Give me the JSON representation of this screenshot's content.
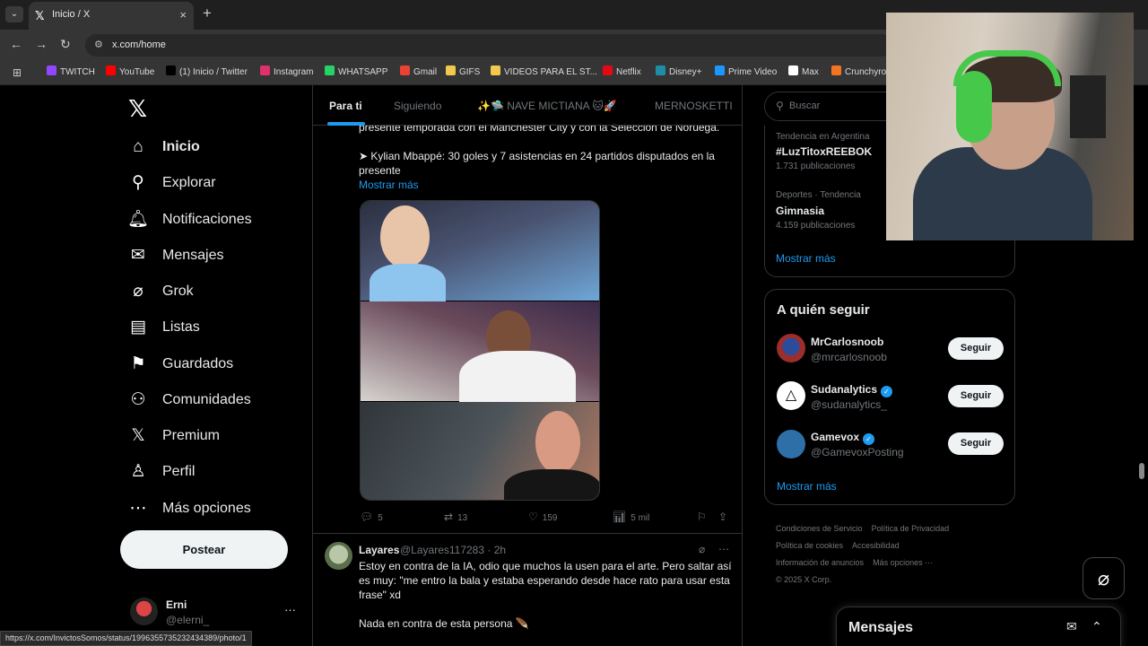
{
  "browser": {
    "tab_title": "Inicio / X",
    "tab_favicon": "𝕏",
    "url": "x.com/home",
    "new_tab": "+",
    "close_tab": "×",
    "bookmarks": [
      {
        "label": "TWITCH",
        "color": "#9146ff"
      },
      {
        "label": "YouTube",
        "color": "#ff0000"
      },
      {
        "label": "(1) Inicio / Twitter",
        "color": "#000000"
      },
      {
        "label": "Instagram",
        "color": "#e1306c"
      },
      {
        "label": "WHATSAPP",
        "color": "#25d366"
      },
      {
        "label": "Gmail",
        "color": "#ea4335"
      },
      {
        "label": "GIFS",
        "color": "#f2c94c"
      },
      {
        "label": "VIDEOS PARA EL ST...",
        "color": "#f2c94c"
      },
      {
        "label": "Netflix",
        "color": "#e50914"
      },
      {
        "label": "Disney+",
        "color": "#1e8ea8"
      },
      {
        "label": "Prime Video",
        "color": "#1a98ff"
      },
      {
        "label": "Max",
        "color": "#ffffff"
      },
      {
        "label": "Crunchyro",
        "color": "#f47521"
      }
    ],
    "status_url": "https://x.com/InvictosSomos/status/1996355735232434389/photo/1"
  },
  "nav": {
    "logo": "𝕏",
    "items": [
      {
        "label": "Inicio",
        "icon": "⌂",
        "active": true
      },
      {
        "label": "Explorar",
        "icon": "⚲"
      },
      {
        "label": "Notificaciones",
        "icon": "🔔︎"
      },
      {
        "label": "Mensajes",
        "icon": "✉"
      },
      {
        "label": "Grok",
        "icon": "⌀"
      },
      {
        "label": "Listas",
        "icon": "▤"
      },
      {
        "label": "Guardados",
        "icon": "⚑"
      },
      {
        "label": "Comunidades",
        "icon": "⚇"
      },
      {
        "label": "Premium",
        "icon": "𝕏"
      },
      {
        "label": "Perfil",
        "icon": "♙"
      },
      {
        "label": "Más opciones",
        "icon": "⋯"
      }
    ],
    "post_label": "Postear",
    "account": {
      "name": "Erni",
      "handle": "@elerni_",
      "more": "···"
    }
  },
  "feed": {
    "tabs": [
      {
        "label": "Para ti",
        "active": true
      },
      {
        "label": "Siguiendo"
      },
      {
        "label": "✨🛸 NAVE MICTIANA 🐱🚀"
      },
      {
        "label": "MERNOSKETTI"
      }
    ],
    "tweet1": {
      "line1": "presente temporada con el Manchester City y con la Selección de Noruega.",
      "line2": "➤ Kylian Mbappé: 30 goles y 7 asistencias en 24 partidos disputados en la",
      "line3": "presente",
      "show_more": "Mostrar más",
      "replies": "5",
      "retweets": "13",
      "likes": "159",
      "views": "5 mil"
    },
    "tweet2": {
      "name": "Layares",
      "handle": "@Layares117283",
      "time": "· 2h",
      "text1": "Estoy en contra de la IA, odio que muchos la usen para el arte. Pero saltar así",
      "text2": "es muy: \"me entro la bala y estaba esperando desde hace rato para usar esta",
      "text3": "frase\" xd",
      "text4": "Nada en contra de esta persona 🪶"
    }
  },
  "sidebar": {
    "search_placeholder": "Buscar",
    "trends": [
      {
        "context": "Tendencia en Argentina",
        "title": "#LuzTitoxREEBOK",
        "count": "1.731 publicaciones"
      },
      {
        "context": "Deportes · Tendencia",
        "title": "Gimnasia",
        "count": "4.159 publicaciones"
      }
    ],
    "trends_more": "Mostrar más",
    "follow_title": "A quién seguir",
    "follow": [
      {
        "name": "MrCarlosnoob",
        "handle": "@mrcarlosnoob",
        "verified": false,
        "button": "Seguir"
      },
      {
        "name": "Sudanalytics",
        "handle": "@sudanalytics_",
        "verified": true,
        "button": "Seguir"
      },
      {
        "name": "Gamevox",
        "handle": "@GamevoxPosting",
        "verified": true,
        "button": "Seguir"
      }
    ],
    "follow_more": "Mostrar más",
    "footer": [
      "Condiciones de Servicio",
      "Política de Privacidad",
      "Política de cookies",
      "Accesibilidad",
      "Información de anuncios",
      "Más opciones ···",
      "© 2025 X Corp."
    ]
  },
  "messages_drawer": {
    "title": "Mensajes"
  }
}
